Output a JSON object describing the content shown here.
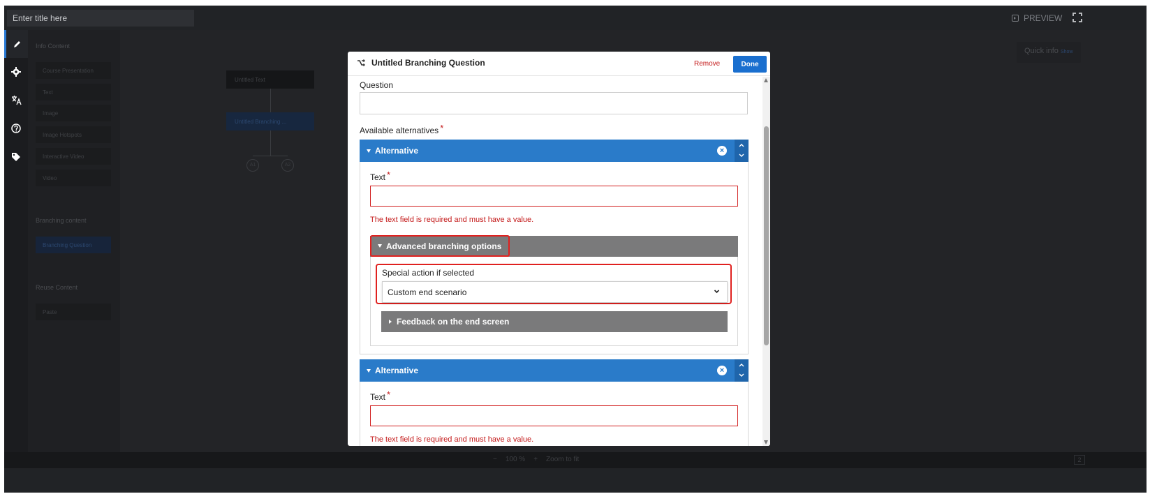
{
  "topbar": {
    "title_placeholder": "Enter title here",
    "preview_label": "PREVIEW"
  },
  "rail": {
    "icons": [
      "pencil-icon",
      "gear-icon",
      "translate-icon",
      "help-icon",
      "tag-icon"
    ]
  },
  "panel": {
    "info_content_label": "Info Content",
    "items": [
      "Course Presentation",
      "Text",
      "Image",
      "Image Hotspots",
      "Interactive Video",
      "Video"
    ],
    "branching_content_label": "Branching content",
    "branching_item": "Branching Question",
    "reuse_content_label": "Reuse Content",
    "reuse_item": "Paste"
  },
  "canvas": {
    "node_text": "Untitled Text",
    "node_branching": "Untitled Branching ...",
    "alt_a1": "A1",
    "alt_a2": "A2",
    "quick_info": "Quick info",
    "quick_info_show": "Show"
  },
  "bottom": {
    "zoom_level": "100 %",
    "zoom_to_fit": "Zoom to fit",
    "badge": "2"
  },
  "modal": {
    "title": "Untitled Branching Question",
    "remove_label": "Remove",
    "done_label": "Done",
    "question_label": "Question",
    "available_alternatives_label": "Available alternatives",
    "required_mark": "*",
    "alternatives": [
      {
        "header": "Alternative",
        "text_label": "Text",
        "error": "The text field is required and must have a value.",
        "advanced_label": "Advanced branching options",
        "special_action_label": "Special action if selected",
        "special_action_value": "Custom end scenario",
        "feedback_label": "Feedback on the end screen"
      },
      {
        "header": "Alternative",
        "text_label": "Text",
        "error": "The text field is required and must have a value."
      }
    ]
  },
  "colors": {
    "accent_blue": "#2a7bc9",
    "done_blue": "#1a6fcf",
    "error_red": "#c41a1a",
    "highlight_red": "#e0211f",
    "dark_bg": "#212326"
  }
}
